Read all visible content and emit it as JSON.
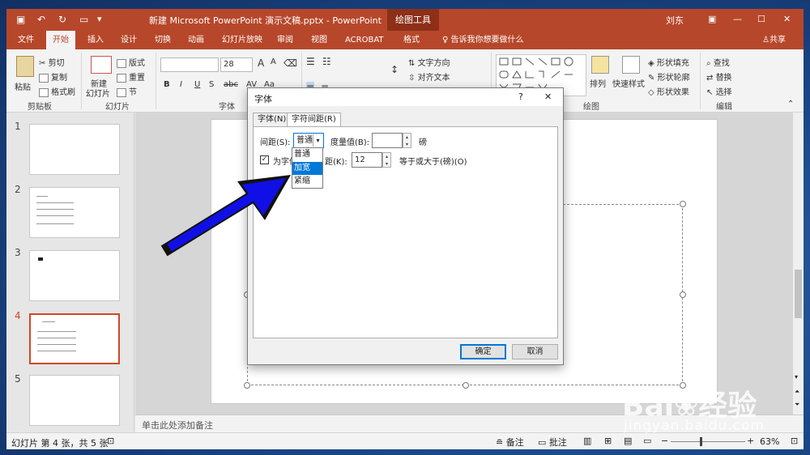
{
  "titlebar": {
    "doc_title": "新建 Microsoft PowerPoint 演示文稿.pptx - PowerPoint",
    "context_tools": "绘图工具",
    "user": "刘东"
  },
  "tabs": [
    "文件",
    "开始",
    "插入",
    "设计",
    "切换",
    "动画",
    "幻灯片放映",
    "审阅",
    "视图",
    "ACROBAT",
    "格式"
  ],
  "tell_me": "告诉我你想要做什么",
  "share": "共享",
  "ribbon": {
    "paste": "粘贴",
    "cut": "剪切",
    "copy": "复制",
    "format_painter": "格式刷",
    "clipboard": "剪贴板",
    "new_slide": "新建",
    "new_slide2": "幻灯片",
    "layout": "版式",
    "reset": "重置",
    "section": "节",
    "slides": "幻灯片",
    "font_size": "28",
    "font_group": "字体",
    "text_direction": "文字方向",
    "align_text": "对齐文本",
    "arrange": "排列",
    "quick_styles": "快速样式",
    "shape_fill": "形状填充",
    "shape_outline": "形状轮廓",
    "shape_effects": "形状效果",
    "drawing": "绘图",
    "find": "查找",
    "replace": "替换",
    "select": "选择",
    "editing": "编辑"
  },
  "slides": [
    {
      "num": "1"
    },
    {
      "num": "2"
    },
    {
      "num": "3"
    },
    {
      "num": "4"
    },
    {
      "num": "5"
    }
  ],
  "notes_placeholder": "单击此处添加备注",
  "status": {
    "slide_info": "幻灯片 第 4 张，共 5 张",
    "notes": "备注",
    "comments": "批注",
    "zoom": "63%"
  },
  "dialog": {
    "title": "字体",
    "help": "?",
    "close": "✕",
    "tab_font": "字体(N)",
    "tab_spacing": "字符间距(R)",
    "spacing_label": "间距(S):",
    "spacing_value": "普通",
    "by_label": "度量值(B):",
    "unit": "磅",
    "kerning_label_a": "为字体",
    "kerning_label_b": "距(K):",
    "kerning_value": "12",
    "kerning_suffix": "等于或大于(磅)(O)",
    "ok": "确定",
    "cancel": "取消",
    "options": [
      "普通",
      "加宽",
      "紧缩"
    ],
    "highlighted_option": "加宽"
  },
  "watermark": {
    "brand": "Bai",
    "brand_cn": "经验",
    "url": "jingyan.baidu.com"
  },
  "colors": {
    "accent": "#b7472a",
    "selection": "#0078d7",
    "arrow": "#1010e6"
  }
}
